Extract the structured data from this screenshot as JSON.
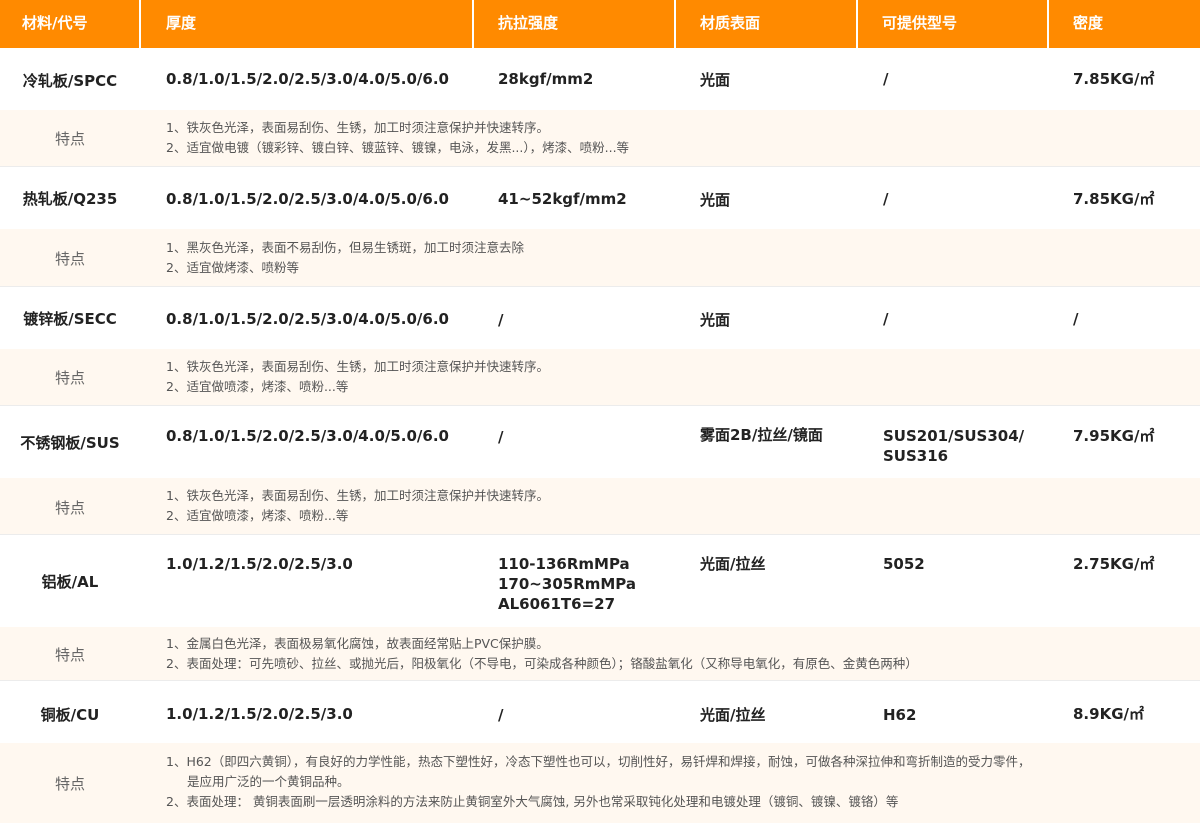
{
  "header": {
    "material": "材料/代号",
    "thickness": "厚度",
    "strength": "抗拉强度",
    "surface": "材质表面",
    "models": "可提供型号",
    "density": "密度"
  },
  "feature_label": "特点",
  "colors": {
    "header_bg": "#ff8a00",
    "note_bg": "#fff8f0"
  },
  "rows": [
    {
      "name": "冷轧板/SPCC",
      "thickness": "0.8/1.0/1.5/2.0/2.5/3.0/4.0/5.0/6.0",
      "strength": [
        "28kgf/mm2"
      ],
      "surface": "光面",
      "models": [
        "/"
      ],
      "density": "7.85KG/㎡",
      "notes": [
        "1、铁灰色光泽，表面易刮伤、生锈，加工时须注意保护并快速转序。",
        "2、适宜做电镀（镀彩锌、镀白锌、镀蓝锌、镀镍，电泳，发黑...），烤漆、喷粉...等"
      ]
    },
    {
      "name": "热轧板/Q235",
      "thickness": "0.8/1.0/1.5/2.0/2.5/3.0/4.0/5.0/6.0",
      "strength": [
        "41~52kgf/mm2"
      ],
      "surface": "光面",
      "models": [
        "/"
      ],
      "density": "7.85KG/㎡",
      "notes": [
        "1、黑灰色光泽，表面不易刮伤，但易生锈斑，加工时须注意去除",
        "2、适宜做烤漆、喷粉等"
      ]
    },
    {
      "name": "镀锌板/SECC",
      "thickness": "0.8/1.0/1.5/2.0/2.5/3.0/4.0/5.0/6.0",
      "strength": [
        " /"
      ],
      "surface": "光面",
      "models": [
        "/"
      ],
      "density": "/",
      "notes": [
        "1、铁灰色光泽，表面易刮伤、生锈，加工时须注意保护并快速转序。",
        "2、适宜做喷漆，烤漆、喷粉...等"
      ]
    },
    {
      "name": "不锈钢板/SUS",
      "thickness": "0.8/1.0/1.5/2.0/2.5/3.0/4.0/5.0/6.0",
      "strength": [
        " /"
      ],
      "surface": "雾面2B/拉丝/镜面",
      "models": [
        "SUS201/SUS304/",
        "SUS316"
      ],
      "density": "7.95KG/㎡",
      "notes": [
        "1、铁灰色光泽，表面易刮伤、生锈，加工时须注意保护并快速转序。",
        "2、适宜做喷漆，烤漆、喷粉...等"
      ]
    },
    {
      "name": "铝板/AL",
      "thickness": "1.0/1.2/1.5/2.0/2.5/3.0",
      "strength": [
        "110-136RmMPa",
        "170~305RmMPa",
        "AL6061T6=27"
      ],
      "surface": "光面/拉丝",
      "models": [
        "5052"
      ],
      "density": "2.75KG/㎡",
      "notes": [
        "1、金属白色光泽，表面极易氧化腐蚀，故表面经常贴上PVC保护膜。",
        "2、表面处理：可先喷砂、拉丝、或抛光后，阳极氧化（不导电，可染成各种颜色）；铬酸盐氧化（又称导电氧化，有原色、金黄色两种）"
      ]
    },
    {
      "name": "铜板/CU",
      "thickness": "1.0/1.2/1.5/2.0/2.5/3.0",
      "strength": [
        " /"
      ],
      "surface": "光面/拉丝",
      "models": [
        "H62"
      ],
      "density": "8.9KG/㎡",
      "notes": [
        "1、H62（即四六黄铜），有良好的力学性能，热态下塑性好，冷态下塑性也可以，切削性好，易钎焊和焊接，耐蚀，可做各种深拉伸和弯折制造的受力零件，",
        "是应用广泛的一个黄铜品种。",
        "2、表面处理： 黄铜表面刷一层透明涂料的方法来防止黄铜室外大气腐蚀, 另外也常采取钝化处理和电镀处理（镀铜、镀镍、镀铬）等"
      ]
    }
  ]
}
